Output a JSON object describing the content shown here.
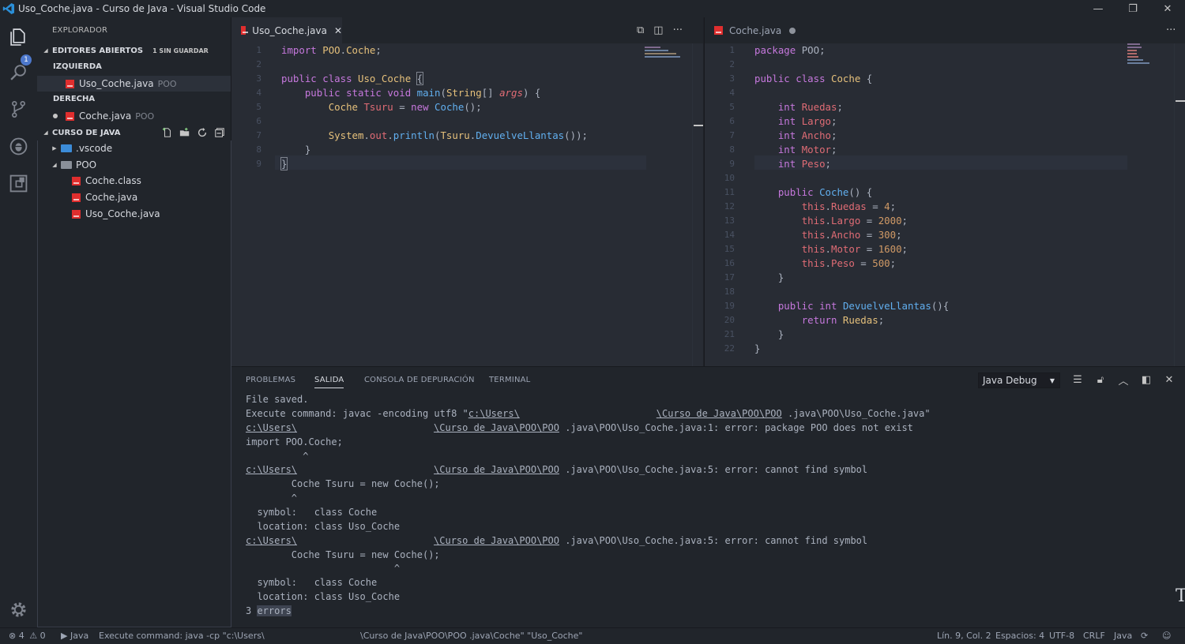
{
  "window": {
    "title": "Uso_Coche.java - Curso de Java - Visual Studio Code"
  },
  "activity_bar": {
    "explorer_badge": "1"
  },
  "sidebar": {
    "title": "EXPLORADOR",
    "open_editors": {
      "header": "EDITORES ABIERTOS",
      "unsaved": "1 SIN GUARDAR",
      "groups": [
        {
          "label": "IZQUIERDA",
          "files": [
            {
              "name": "Uso_Coche.java",
              "folder": "POO"
            }
          ]
        },
        {
          "label": "DERECHA",
          "files": [
            {
              "name": "Coche.java",
              "folder": "POO"
            }
          ]
        }
      ]
    },
    "workspace": {
      "header": "CURSO DE JAVA",
      "tree": [
        {
          "name": ".vscode"
        },
        {
          "name": "POO"
        },
        {
          "name": "Coche.class"
        },
        {
          "name": "Coche.java"
        },
        {
          "name": "Uso_Coche.java"
        }
      ]
    }
  },
  "editor_left": {
    "tab": "Uso_Coche.java",
    "lines": [
      "import POO.Coche;",
      "",
      "public class Uso_Coche {",
      "    public static void main(String[] args) {",
      "        Coche Tsuru = new Coche();",
      "",
      "        System.out.println(Tsuru.DevuelveLlantas());",
      "    }",
      "}"
    ]
  },
  "editor_right": {
    "tab": "Coche.java",
    "lines": [
      "package POO;",
      "",
      "public class Coche {",
      "",
      "    int Ruedas;",
      "    int Largo;",
      "    int Ancho;",
      "    int Motor;",
      "    int Peso;",
      "",
      "    public Coche() {",
      "        this.Ruedas = 4;",
      "        this.Largo = 2000;",
      "        this.Ancho = 300;",
      "        this.Motor = 1600;",
      "        this.Peso = 500;",
      "    }",
      "",
      "    public int DevuelveLlantas(){",
      "        return Ruedas;",
      "    }",
      "}"
    ]
  },
  "panel": {
    "tabs": [
      "PROBLEMAS",
      "SALIDA",
      "CONSOLA DE DEPURACIÓN",
      "TERMINAL"
    ],
    "active_tab": "SALIDA",
    "output_channel": "Java Debug",
    "output": {
      "l1": "File saved.",
      "l2a": "Execute command: javac -encoding utf8 \"",
      "l2b": "c:\\Users\\",
      "l2c": "\\Curso de Java\\POO\\POO",
      "l2d": " .java\\POO\\Uso_Coche.java\"",
      "l3a": "c:\\Users\\",
      "l3b": "\\Curso de Java\\POO\\POO",
      "l3c": " .java\\POO\\Uso_Coche.java:1: error: package POO does not exist",
      "l4": "import POO.Coche;",
      "l5": "          ^",
      "l6a": "c:\\Users\\",
      "l6b": "\\Curso de Java\\POO\\POO",
      "l6c": " .java\\POO\\Uso_Coche.java:5: error: cannot find symbol",
      "l7": "        Coche Tsuru = new Coche();",
      "l8": "        ^",
      "l9": "  symbol:   class Coche",
      "l10": "  location: class Uso_Coche",
      "l11a": "c:\\Users\\",
      "l11b": "\\Curso de Java\\POO\\POO",
      "l11c": " .java\\POO\\Uso_Coche.java:5: error: cannot find symbol",
      "l12": "        Coche Tsuru = new Coche();",
      "l13": "                          ^",
      "l14": "  symbol:   class Coche",
      "l15": "  location: class Uso_Coche",
      "l16a": "3 ",
      "l16b": "errors"
    }
  },
  "status_bar": {
    "errors": "4",
    "warnings": "0",
    "language_run": "Java",
    "message_left": "Execute command: java -cp \"c:\\Users\\",
    "message_right": "\\Curso de Java\\POO\\POO .java\\Coche\" \"Uso_Coche\"",
    "position": "Lín. 9, Col. 2",
    "spaces": "Espacios: 4",
    "encoding": "UTF-8",
    "eol": "CRLF",
    "language": "Java"
  },
  "colors": {
    "accent": "#4d78cc",
    "java_icon": "#e02e2e",
    "background": "#282c34",
    "chrome": "#21252b"
  }
}
